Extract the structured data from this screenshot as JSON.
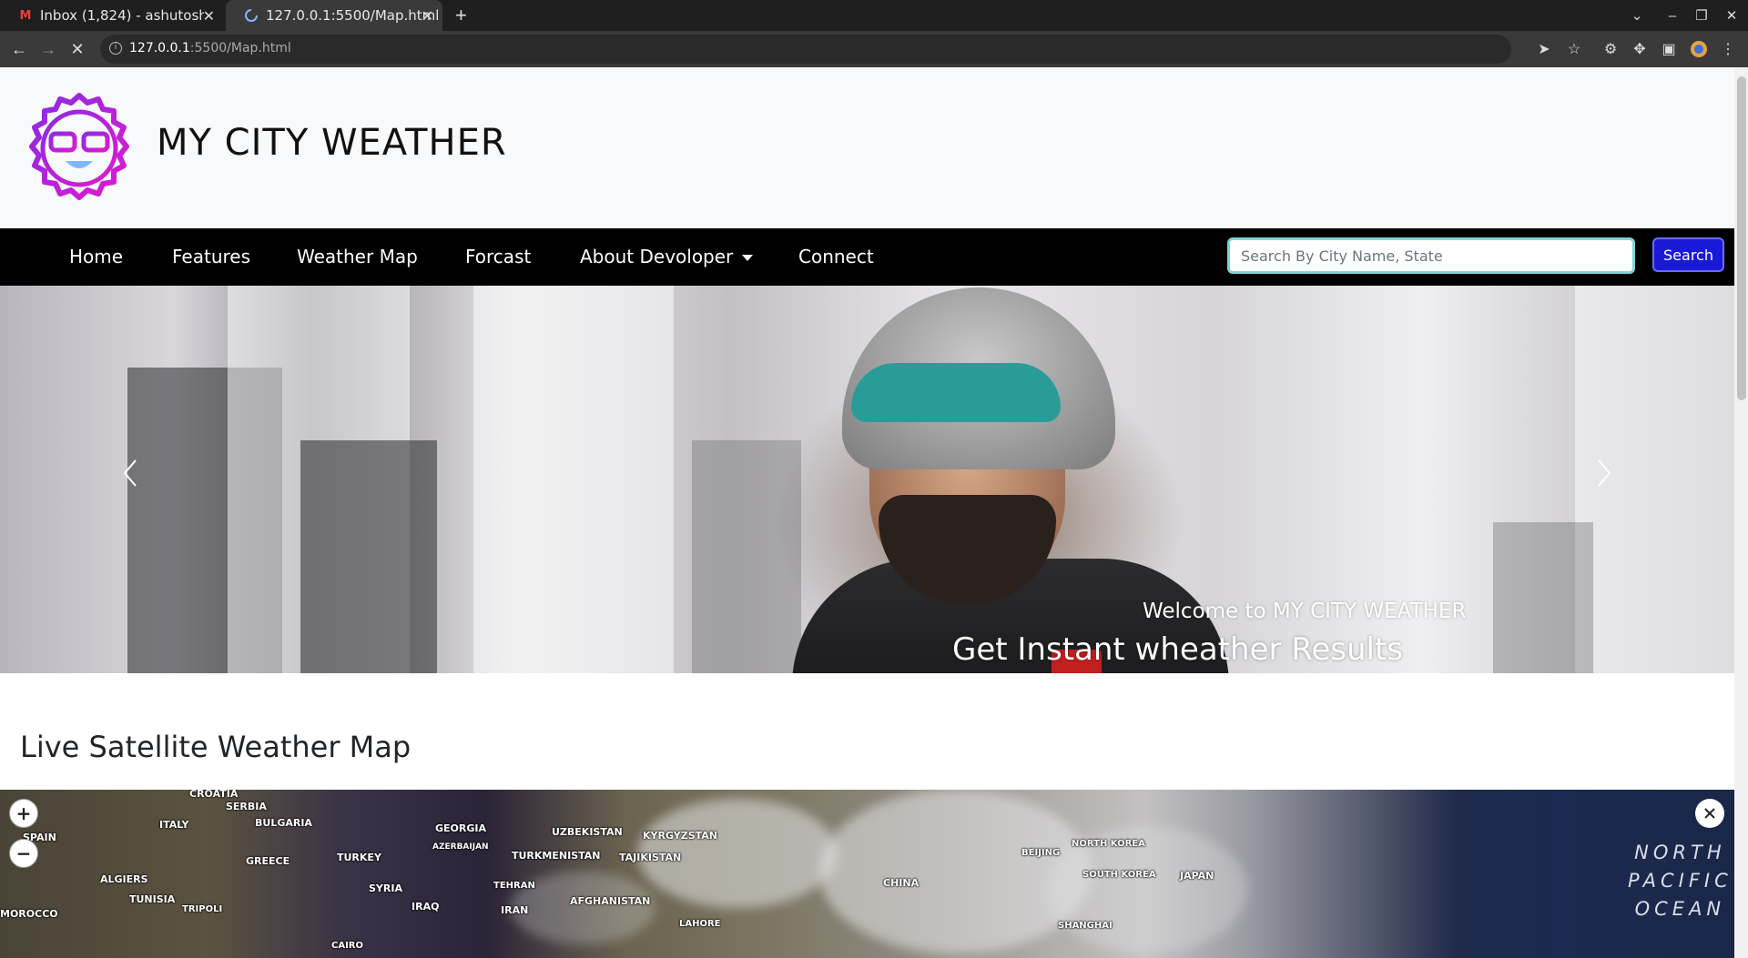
{
  "browser": {
    "tabs": [
      {
        "title": "Inbox (1,824) - ashutosh.s",
        "active": false,
        "icon": "gmail-icon"
      },
      {
        "title": "127.0.0.1:5500/Map.html",
        "active": true,
        "icon": "loading-icon"
      }
    ],
    "url_host": "127.0.0.1",
    "url_rest": ":5500/Map.html"
  },
  "header": {
    "brand": "MY CITY WEATHER",
    "logo_icon": "sun-glasses-logo-icon"
  },
  "nav": {
    "items": [
      "Home",
      "Features",
      "Weather Map",
      "Forcast",
      "About Devoloper",
      "Connect"
    ],
    "search_placeholder": "Search By City Name, State",
    "search_button": "Search"
  },
  "hero": {
    "caption_small": "Welcome to MY CITY WEATHER",
    "caption_big": "Get Instant wheather Results"
  },
  "section": {
    "title": "Live Satellite Weather Map"
  },
  "map": {
    "zoom_in": "+",
    "zoom_out": "−",
    "labels": [
      "CROATIA",
      "SERBIA",
      "ITALY",
      "BULGARIA",
      "SPAIN",
      "GEORGIA",
      "UZBEKISTAN",
      "KYRGYZSTAN",
      "AZERBAIJAN",
      "GREECE",
      "TURKEY",
      "TURKMENISTAN",
      "TAJIKISTAN",
      "ALGIERS",
      "TUNISIA",
      "SYRIA",
      "TEHRAN",
      "AFGHANISTAN",
      "MOROCCO",
      "TRIPOLI",
      "IRAQ",
      "IRAN",
      "LAHORE",
      "CAIRO",
      "CHINA",
      "BEIJING",
      "NORTH KOREA",
      "SOUTH KOREA",
      "JAPAN",
      "SHANGHAI"
    ],
    "ocean": [
      "NORTH",
      "PACIFIC",
      "OCEAN"
    ]
  },
  "colors": {
    "nav_bg": "#000000",
    "search_btn": "#1a1ad6",
    "logo_purple": "#b31fe0"
  }
}
